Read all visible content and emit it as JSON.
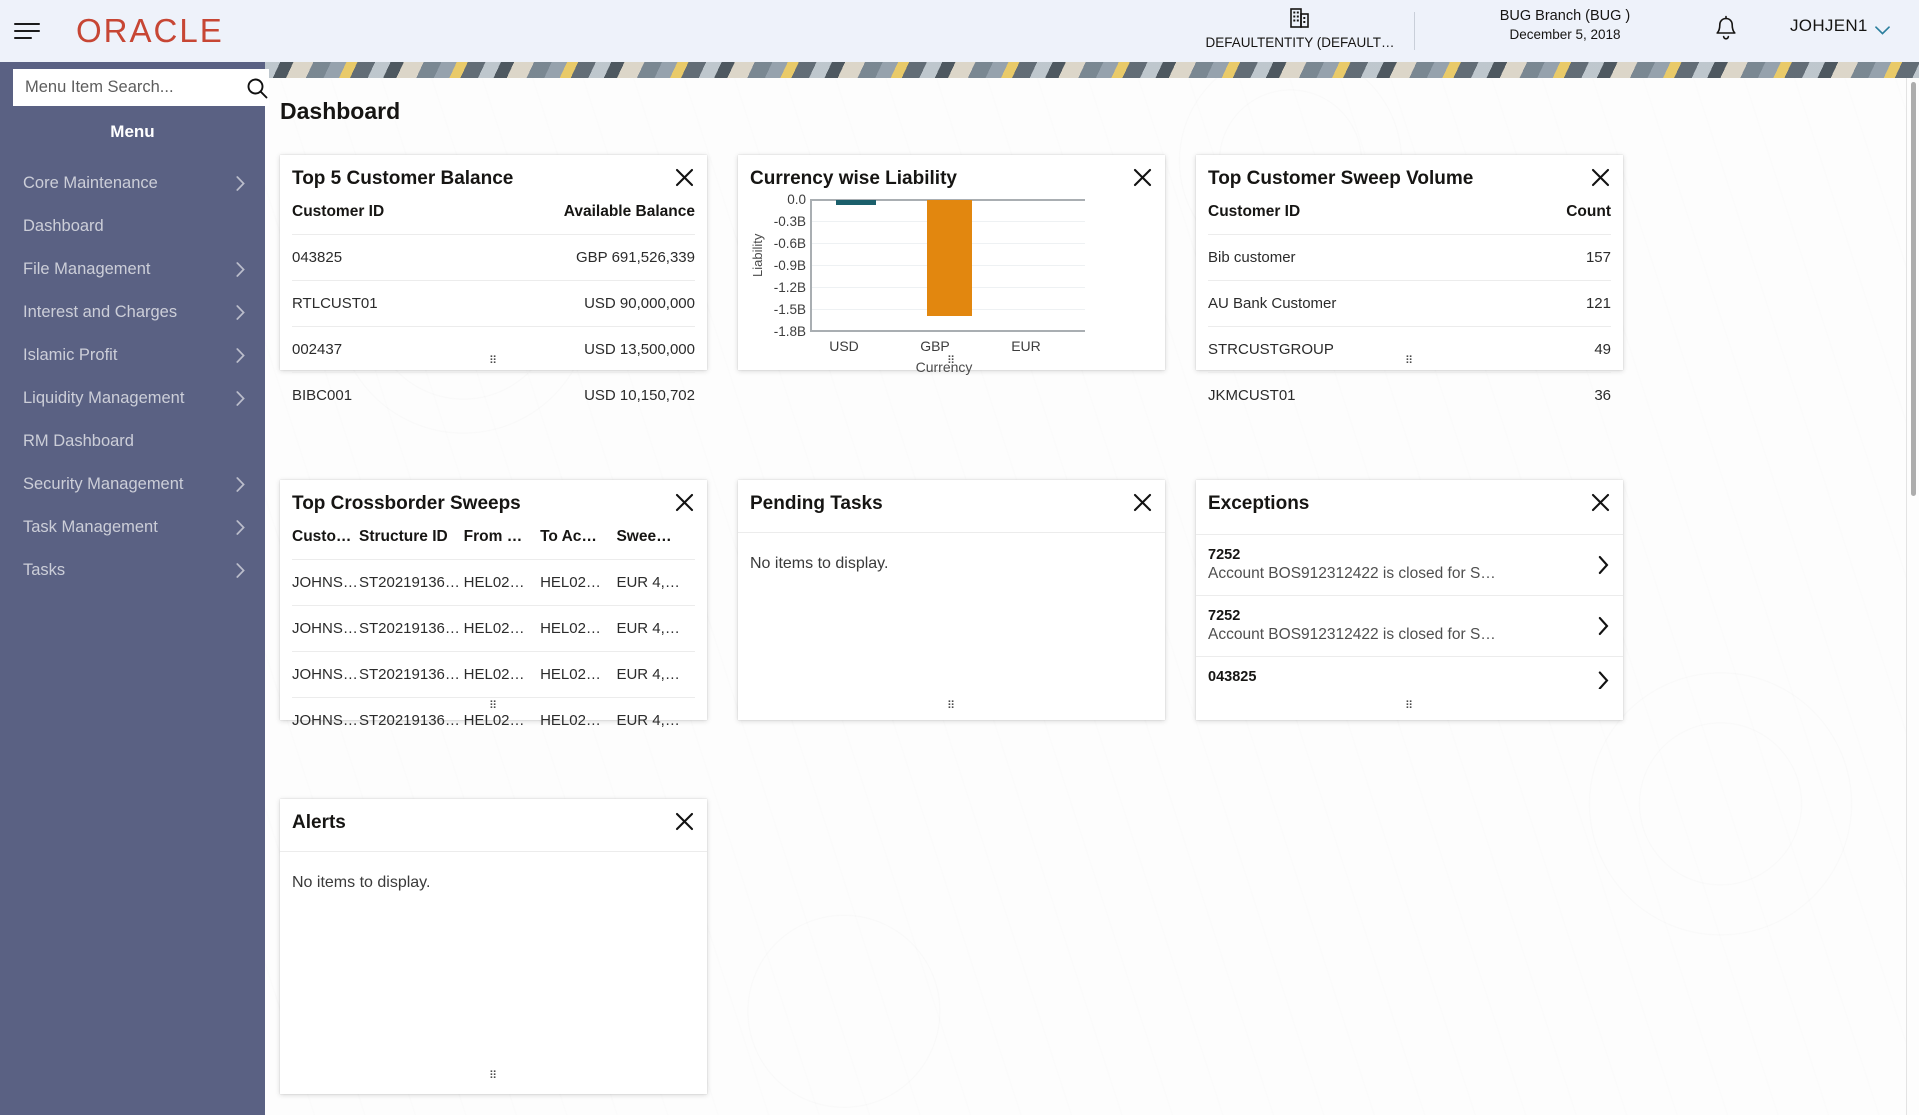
{
  "header": {
    "logo_text": "ORACLE",
    "menu_icon": "hamburger-icon",
    "entity_icon": "building-icon",
    "entity_label": "DEFAULTENTITY (DEFAULT…",
    "branch_name": "BUG Branch  (BUG )",
    "branch_date": "December 5, 2018",
    "notification_icon": "bell-icon",
    "user_name": "JOHJEN1",
    "user_chevron_icon": "chevron-down-icon"
  },
  "sidebar": {
    "search_placeholder": "Menu Item Search...",
    "search_value": "",
    "search_icon": "search-icon",
    "menu_heading": "Menu",
    "items": [
      {
        "label": "Core Maintenance",
        "has_chevron": true
      },
      {
        "label": "Dashboard",
        "has_chevron": false
      },
      {
        "label": "File Management",
        "has_chevron": true
      },
      {
        "label": "Interest and Charges",
        "has_chevron": true
      },
      {
        "label": "Islamic Profit",
        "has_chevron": true
      },
      {
        "label": "Liquidity Management",
        "has_chevron": true
      },
      {
        "label": "RM Dashboard",
        "has_chevron": false
      },
      {
        "label": "Security Management",
        "has_chevron": true
      },
      {
        "label": "Task Management",
        "has_chevron": true
      },
      {
        "label": "Tasks",
        "has_chevron": true
      }
    ]
  },
  "main": {
    "page_title": "Dashboard",
    "add_tile_label": "+",
    "close_icon": "close-icon",
    "grip_icon": "drag-grip-icon",
    "chevron_right_icon": "chevron-right-icon"
  },
  "cards": {
    "top_customer_balance": {
      "title": "Top 5 Customer Balance",
      "columns": [
        "Customer ID",
        "Available Balance"
      ],
      "rows": [
        [
          "043825",
          "GBP 691,526,339"
        ],
        [
          "RTLCUST01",
          "USD 90,000,000"
        ],
        [
          "002437",
          "USD 13,500,000"
        ],
        [
          "BIBC001",
          "USD 10,150,702"
        ]
      ]
    },
    "currency_wise_liability": {
      "title": "Currency wise Liability"
    },
    "top_customer_sweep_volume": {
      "title": "Top Customer Sweep Volume",
      "columns": [
        "Customer ID",
        "Count"
      ],
      "rows": [
        [
          "Bib customer",
          "157"
        ],
        [
          "AU Bank Customer",
          "121"
        ],
        [
          "STRCUSTGROUP",
          "49"
        ],
        [
          "JKMCUST01",
          "36"
        ]
      ]
    },
    "top_crossborder_sweeps": {
      "title": "Top Crossborder Sweeps",
      "columns": [
        "Custo…",
        "Structure ID",
        "From …",
        "To Ac…",
        "Swee…"
      ],
      "rows": [
        [
          "JOHNS…",
          "ST20219136…",
          "HEL02…",
          "HEL02…",
          "EUR 4,…"
        ],
        [
          "JOHNS…",
          "ST20219136…",
          "HEL02…",
          "HEL02…",
          "EUR 4,…"
        ],
        [
          "JOHNS…",
          "ST20219136…",
          "HEL02…",
          "HEL02…",
          "EUR 4,…"
        ],
        [
          "JOHNS…",
          "ST20219136…",
          "HEL02…",
          "HEL02…",
          "EUR 4,…"
        ]
      ]
    },
    "pending_tasks": {
      "title": "Pending Tasks",
      "empty_text": "No items to display."
    },
    "exceptions": {
      "title": "Exceptions",
      "rows": [
        {
          "id": "7252",
          "desc": "Account BOS912312422 is closed for S…"
        },
        {
          "id": "7252",
          "desc": "Account BOS912312422 is closed for S…"
        },
        {
          "id": "043825",
          "desc": ""
        }
      ]
    },
    "alerts": {
      "title": "Alerts",
      "empty_text": "No items to display."
    }
  },
  "chart_data": {
    "type": "bar",
    "title": "Currency wise Liability",
    "xlabel": "Currency",
    "ylabel": "Liability",
    "categories": [
      "USD",
      "GBP",
      "EUR"
    ],
    "values": [
      -0.012,
      -1.58,
      0
    ],
    "ytick_labels": [
      "0.0",
      "-0.3B",
      "-0.6B",
      "-0.9B",
      "-1.2B",
      "-1.5B",
      "-1.8B"
    ],
    "ytick_values": [
      0,
      -0.3,
      -0.6,
      -0.9,
      -1.2,
      -1.5,
      -1.8
    ],
    "ylim": [
      -1.8,
      0
    ],
    "grid": true,
    "legend": "none",
    "bar_colors": [
      "#1b5f6b",
      "#e2870f",
      "#e2870f"
    ]
  },
  "colors": {
    "oracle_red": "#c74634",
    "sidebar_bg": "#5a6183",
    "header_bg": "#eef2fa",
    "accent_teal": "#1b5f6b",
    "accent_orange": "#e2870f"
  }
}
